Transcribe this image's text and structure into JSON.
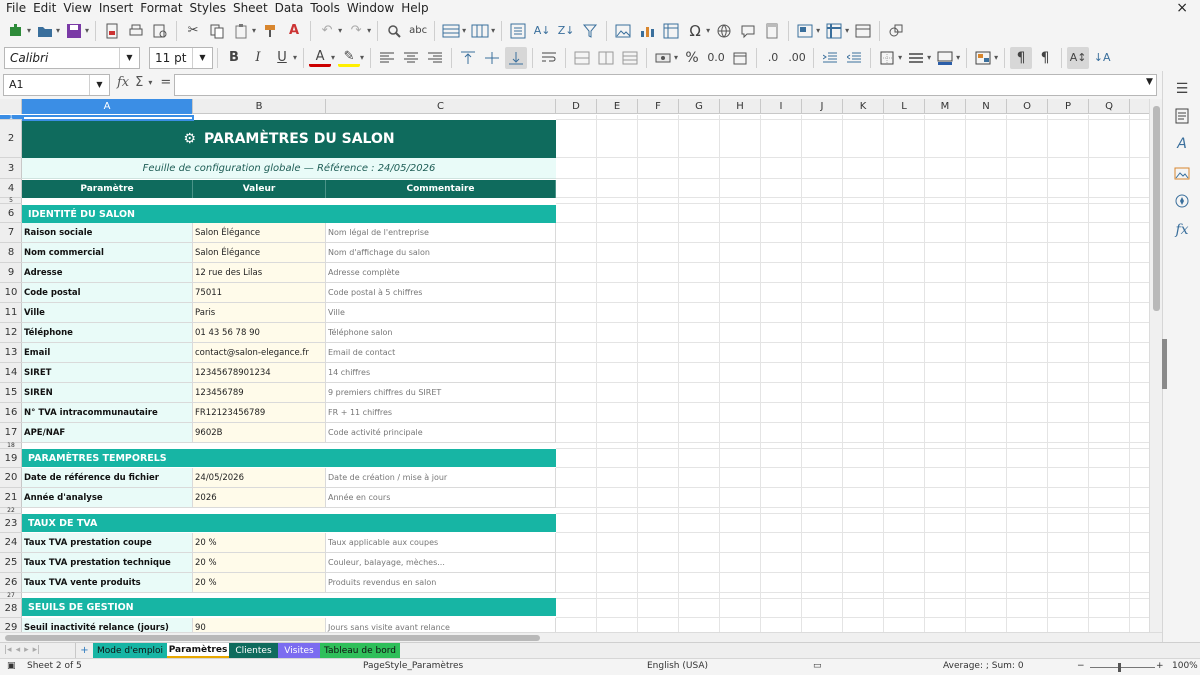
{
  "menubar": {
    "items": [
      "File",
      "Edit",
      "View",
      "Insert",
      "Format",
      "Styles",
      "Sheet",
      "Data",
      "Tools",
      "Window",
      "Help"
    ],
    "close_glyph": "×"
  },
  "toolbar": {
    "font_name": "Calibri",
    "font_size": "11 pt",
    "icons": [
      "new-icon",
      "open-icon",
      "save-icon",
      "export-pdf-icon",
      "print-icon",
      "print-preview-icon",
      "cut-icon",
      "copy-icon",
      "paste-icon",
      "clone-formatting-icon",
      "clear-formatting-icon",
      "undo-icon",
      "redo-icon",
      "find-replace-icon",
      "spellcheck-icon",
      "row-icon",
      "column-icon",
      "sort-icon",
      "sort-ascending-icon",
      "sort-descending-icon",
      "autofilter-icon",
      "image-icon",
      "chart-icon",
      "pivot-table-icon",
      "special-character-icon",
      "hyperlink-icon",
      "comment-icon",
      "header-footer-icon",
      "define-print-area-icon",
      "freeze-rows-columns-icon",
      "split-window-icon",
      "show-draw-functions-icon"
    ],
    "format_icons": [
      "bold-icon",
      "italic-icon",
      "underline-icon",
      "font-color-icon",
      "highlighting-color-icon",
      "align-left-icon",
      "align-center-icon",
      "align-right-icon",
      "align-top-icon",
      "center-vertically-icon",
      "align-bottom-icon",
      "wrap-text-icon",
      "merge-center-icon",
      "merge-cells-icon",
      "unmerge-cells-icon",
      "currency-icon",
      "percent-icon",
      "number-icon",
      "date-icon",
      "add-decimal-icon",
      "delete-decimal-icon",
      "increase-indent-icon",
      "decrease-indent-icon",
      "borders-icon",
      "border-style-icon",
      "border-color-icon",
      "conditional-icon",
      "left-to-right-icon",
      "right-to-left-icon",
      "text-direction-ltr-icon",
      "text-direction-ttb-icon"
    ]
  },
  "formula_bar": {
    "cell_ref": "A1",
    "value": ""
  },
  "columns": [
    "A",
    "B",
    "C",
    "D",
    "E",
    "F",
    "G",
    "H",
    "I",
    "J",
    "K",
    "L",
    "M",
    "N",
    "O",
    "P",
    "Q"
  ],
  "rows": [
    "1",
    "2",
    "3",
    "4",
    "5",
    "6",
    "7",
    "8",
    "9",
    "10",
    "11",
    "12",
    "13",
    "14",
    "15",
    "16",
    "17",
    "18",
    "19",
    "20",
    "21",
    "22",
    "23",
    "24",
    "25",
    "26",
    "27",
    "28",
    "29"
  ],
  "sheet": {
    "title_icon": "⚙",
    "title": "PARAMÈTRES DU SALON",
    "subtitle": "Feuille de configuration globale — Référence : 24/05/2026",
    "headers": [
      "Paramètre",
      "Valeur",
      "Commentaire"
    ],
    "sections": {
      "identite": {
        "label": "IDENTITÉ DU SALON",
        "rows": [
          [
            "Raison sociale",
            "Salon Élégance",
            "Nom légal de l'entreprise"
          ],
          [
            "Nom commercial",
            "Salon Élégance",
            "Nom d'affichage du salon"
          ],
          [
            "Adresse",
            "12 rue des Lilas",
            "Adresse complète"
          ],
          [
            "Code postal",
            "75011",
            "Code postal à 5 chiffres"
          ],
          [
            "Ville",
            "Paris",
            "Ville"
          ],
          [
            "Téléphone",
            "01 43 56 78 90",
            "Téléphone salon"
          ],
          [
            "Email",
            "contact@salon-elegance.fr",
            "Email de contact"
          ],
          [
            "SIRET",
            "12345678901234",
            "14 chiffres"
          ],
          [
            "SIREN",
            "123456789",
            "9 premiers chiffres du SIRET"
          ],
          [
            "N° TVA intracommunautaire",
            "FR12123456789",
            "FR + 11 chiffres"
          ],
          [
            "APE/NAF",
            "9602B",
            "Code activité principale"
          ]
        ]
      },
      "temporels": {
        "label": "PARAMÈTRES TEMPORELS",
        "rows": [
          [
            "Date de référence du fichier",
            "24/05/2026",
            "Date de création / mise à jour"
          ],
          [
            "Année d'analyse",
            "2026",
            "Année en cours"
          ]
        ]
      },
      "tva": {
        "label": "TAUX DE TVA",
        "rows": [
          [
            "Taux TVA prestation coupe",
            "20 %",
            "Taux applicable aux coupes"
          ],
          [
            "Taux TVA prestation technique",
            "20 %",
            "Couleur, balayage, mèches..."
          ],
          [
            "Taux TVA vente produits",
            "20 %",
            "Produits revendus en salon"
          ]
        ]
      },
      "seuils": {
        "label": "SEUILS DE GESTION",
        "rows": [
          [
            "Seuil inactivité relance (jours)",
            "90",
            "Jours sans visite avant relance"
          ]
        ]
      }
    }
  },
  "tabs": [
    {
      "label": "Mode d'emploi",
      "color": "#17b5a4"
    },
    {
      "label": "Paramètres",
      "color": "#ffffff"
    },
    {
      "label": "Clientes",
      "color": "#0f6b5d"
    },
    {
      "label": "Visites",
      "color": "#7b6cf0"
    },
    {
      "label": "Tableau de bord",
      "color": "#2fbf5a"
    }
  ],
  "statusbar": {
    "sheet_pos": "Sheet 2 of 5",
    "page_style": "PageStyle_Paramètres",
    "language": "English (USA)",
    "summary": "Average: ; Sum: 0",
    "zoom": "100%"
  },
  "colors": {
    "title_band": "#0f6b5d",
    "section_band": "#17b5a4",
    "label_fill": "#e9fbf8",
    "value_fill": "#fffbea",
    "selection": "#3b8ee5"
  }
}
